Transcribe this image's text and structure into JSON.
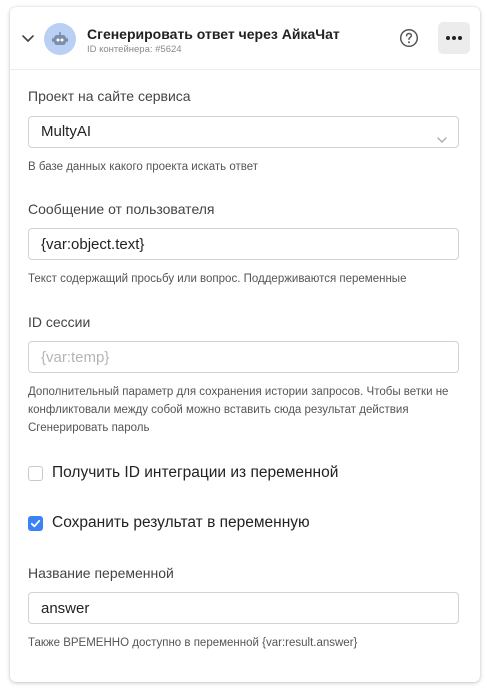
{
  "header": {
    "title": "Сгенерировать ответ через АйкаЧат",
    "subtitle": "ID контейнера: #5624"
  },
  "project": {
    "label": "Проект на сайте сервиса",
    "value": "MultyAI",
    "hint": "В базе данных какого проекта искать ответ"
  },
  "message": {
    "label": "Сообщение от пользователя",
    "value": "{var:object.text}",
    "hint": "Текст содержащий просьбу или вопрос. Поддерживаются переменные"
  },
  "session": {
    "label": "ID сессии",
    "placeholder": "{var:temp}",
    "hint": "Дополнительный параметр для сохранения истории запросов. Чтобы ветки не конфликтовали между собой можно вставить сюда результат действия Сгенерировать пароль"
  },
  "checkbox_integration": {
    "label": "Получить ID интеграции из переменной",
    "checked": false
  },
  "checkbox_save": {
    "label": "Сохранить результат в переменную",
    "checked": true
  },
  "variable": {
    "label": "Название переменной",
    "value": "answer",
    "hint": "Также ВРЕМЕННО доступно в переменной {var:result.answer}"
  },
  "colors": {
    "accent": "#3b82f6",
    "avatar_bg": "#b9cff4"
  },
  "icons": {
    "collapse": "chevron-down-icon",
    "avatar": "robot-icon",
    "help": "question-circle-icon",
    "more": "more-dots-icon",
    "select": "chevron-down-icon",
    "check": "checkmark-icon"
  }
}
